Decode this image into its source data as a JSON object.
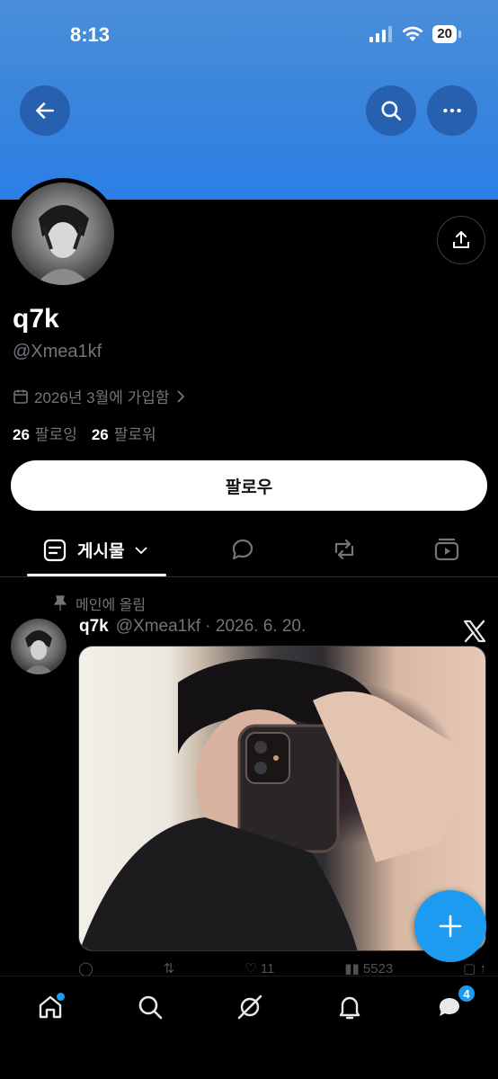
{
  "status_bar": {
    "time": "8:13",
    "battery": "20"
  },
  "header": {
    "back_icon": "arrow-left-icon",
    "search_icon": "search-icon",
    "more_icon": "more-horizontal-icon"
  },
  "profile": {
    "display_name": "q7k",
    "handle": "@Xmea1kf",
    "joined": "2026년 3월에 가입함",
    "following_count": "26",
    "following_label": "팔로잉",
    "followers_count": "26",
    "followers_label": "팔로워",
    "follow_button": "팔로우"
  },
  "tabs": {
    "posts_label": "게시물"
  },
  "post": {
    "pinned_label": "메인에 올림",
    "author_name": "q7k",
    "meta": "@Xmea1kf · 2026. 6. 20.",
    "likes": "11",
    "views": "5523"
  },
  "bottom_nav": {
    "messages_badge": "4"
  },
  "colors": {
    "accent": "#1d9bf0",
    "banner": "#3b86dc",
    "background": "#000000"
  }
}
